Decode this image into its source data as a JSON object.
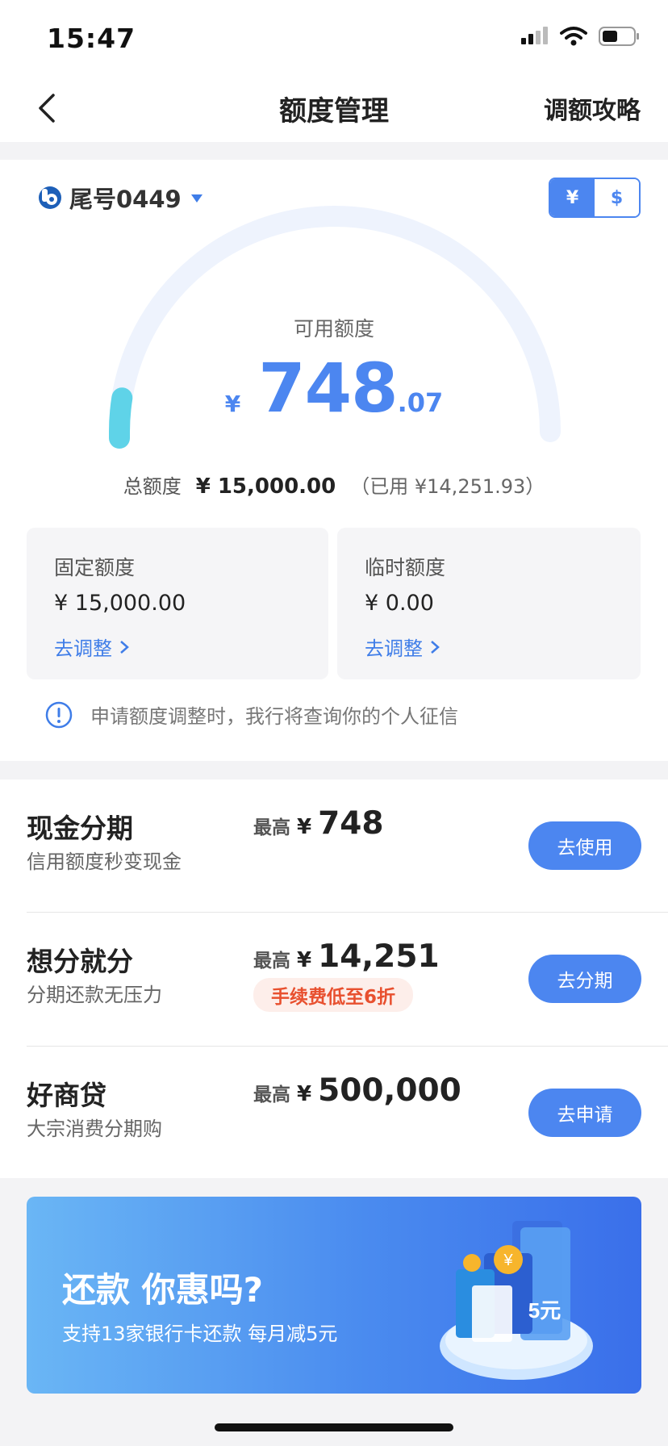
{
  "status": {
    "time": "15:47"
  },
  "nav": {
    "title": "额度管理",
    "right": "调额攻略"
  },
  "account": {
    "label": "尾号0449"
  },
  "currency": {
    "cny": "¥",
    "usd": "$"
  },
  "credit": {
    "available_label": "可用额度",
    "symbol": "¥",
    "available_int": "748",
    "available_dec": ".07",
    "total_label": "总额度",
    "total_value": "¥ 15,000.00",
    "used_text": "（已用 ¥14,251.93）",
    "gauge_fraction": 0.05
  },
  "fixed": {
    "title": "固定额度",
    "value": "¥ 15,000.00",
    "link": "去调整"
  },
  "temp": {
    "title": "临时额度",
    "value": "¥ 0.00",
    "link": "去调整"
  },
  "notice": "申请额度调整时，我行将查询你的个人征信",
  "products": [
    {
      "name": "现金分期",
      "desc": "信用额度秒变现金",
      "max_label": "最高",
      "symbol": "¥",
      "max_value": "748",
      "button": "去使用"
    },
    {
      "name": "想分就分",
      "desc": "分期还款无压力",
      "max_label": "最高",
      "symbol": "¥",
      "max_value": "14,251",
      "tag": "手续费低至6折",
      "button": "去分期"
    },
    {
      "name": "好商贷",
      "desc": "大宗消费分期购",
      "max_label": "最高",
      "symbol": "¥",
      "max_value": "500,000",
      "button": "去申请"
    }
  ],
  "banner": {
    "title": "还款 你惠吗?",
    "subtitle": "支持13家银行卡还款 每月减5元",
    "art_text": "5元"
  },
  "colors": {
    "accent": "#4c86f0",
    "gauge_fill": "#5fd3e8",
    "tag_text": "#e8502f"
  }
}
